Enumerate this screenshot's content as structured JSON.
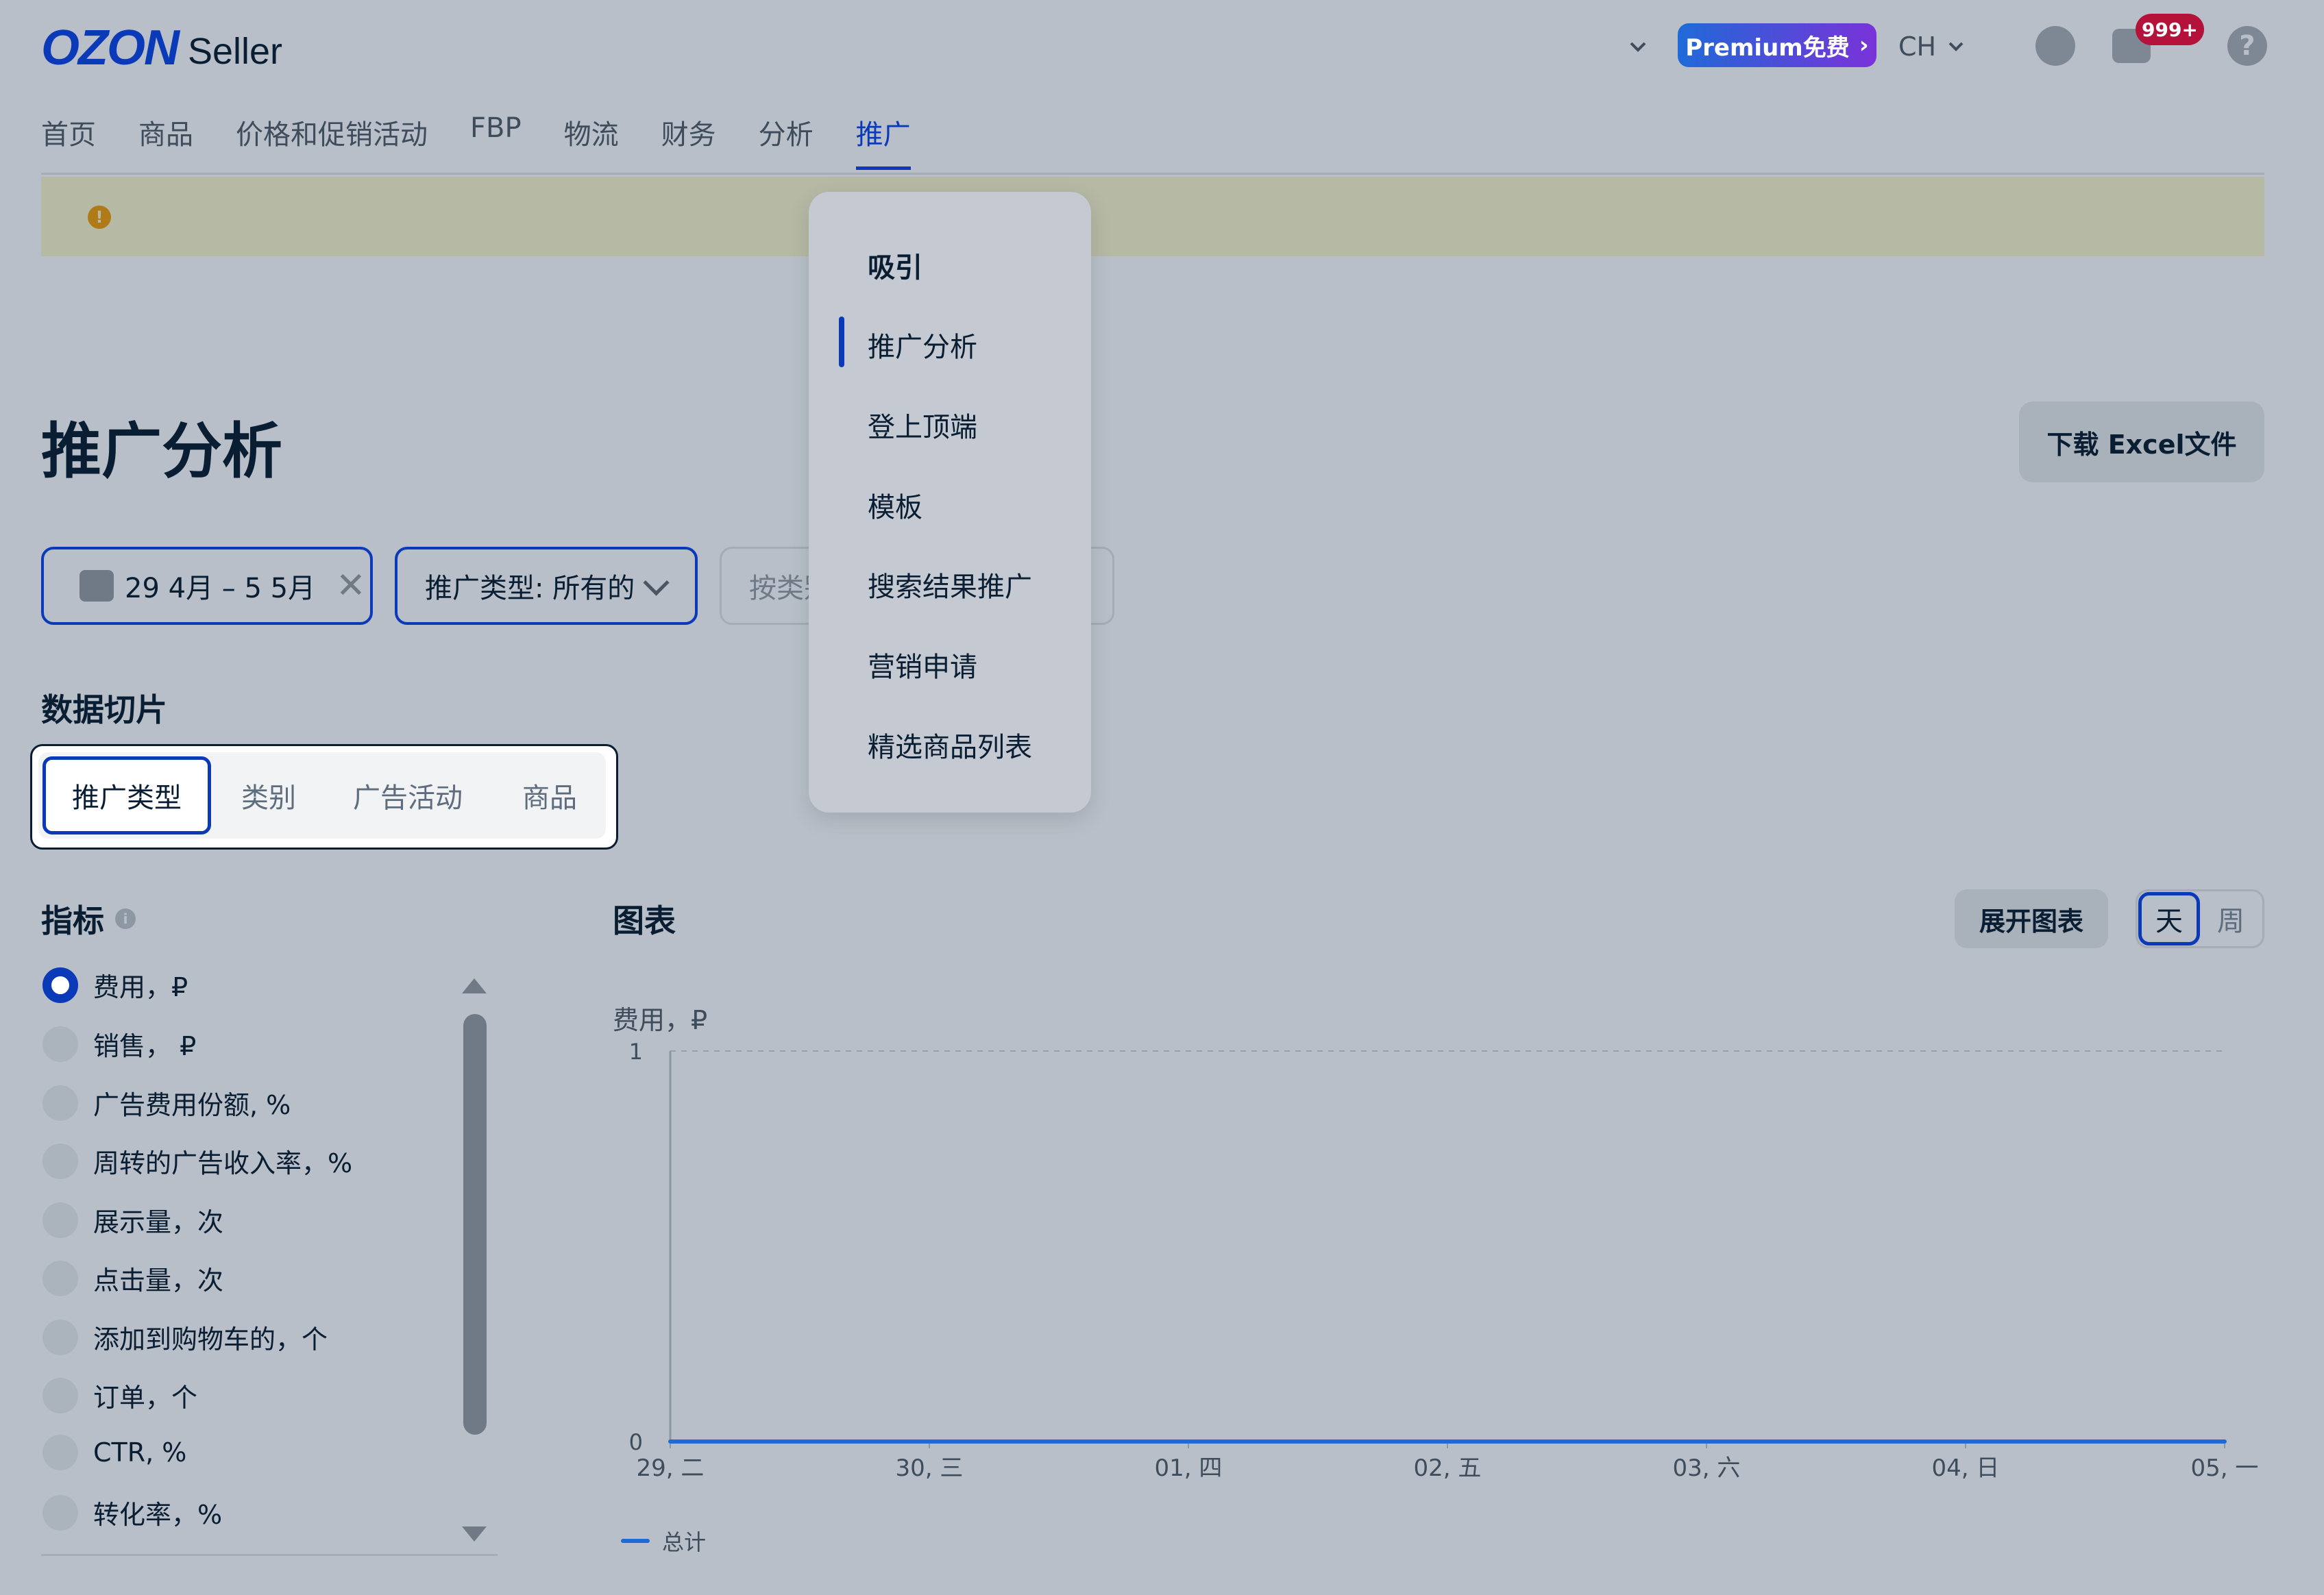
{
  "header": {
    "logo_brand": "OZON",
    "logo_product": "Seller",
    "premium_label": "Premium免费",
    "language": "CH",
    "notifications_badge": "999+",
    "help": "?"
  },
  "nav": {
    "items": [
      "首页",
      "商品",
      "价格和促销活动",
      "FBP",
      "物流",
      "财务",
      "分析",
      "推广"
    ],
    "active_index": 7
  },
  "page": {
    "title": "推广分析",
    "download_label": "下载 Excel文件"
  },
  "filters": {
    "date_range": "29 4月 – 5 5月",
    "promo_type": "推广类型: 所有的",
    "category_placeholder": "按类别"
  },
  "data_slice": {
    "title": "数据切片",
    "tabs": [
      "推广类型",
      "类别",
      "广告活动",
      "商品"
    ],
    "active_index": 0
  },
  "promo_menu": {
    "items": [
      "吸引",
      "推广分析",
      "登上顶端",
      "模板",
      "搜索结果推广",
      "营销申请",
      "精选商品列表"
    ],
    "active_index": 1
  },
  "metrics": {
    "title": "指标",
    "items": [
      "费用，₽",
      "销售， ₽",
      "广告费用份额, %",
      "周转的广告收入率，%",
      "展示量，次",
      "点击量，次",
      "添加到购物车的，个",
      "订单，个",
      "CTR, %",
      "转化率，%"
    ],
    "selected_index": 0
  },
  "chart_panel": {
    "title": "图表",
    "expand_label": "展开图表",
    "period_options": [
      "天",
      "周"
    ],
    "period_selected": "天"
  },
  "chart_data": {
    "type": "line",
    "title": "",
    "ylabel": "费用，₽",
    "xlabel": "",
    "categories": [
      "29, 二",
      "30, 三",
      "01, 四",
      "02, 五",
      "03, 六",
      "04, 日",
      "05, 一"
    ],
    "series": [
      {
        "name": "总计",
        "values": [
          0,
          0,
          0,
          0,
          0,
          0,
          0
        ]
      }
    ],
    "ylim": [
      0,
      1
    ],
    "yticks": [
      "0",
      "1"
    ],
    "grid": true,
    "legend": "bottom-left",
    "series_color": "#1f6ad8"
  },
  "colors": {
    "accent": "#0a3ab8",
    "badge": "#b5123b",
    "banner": "#b6b9a4"
  }
}
